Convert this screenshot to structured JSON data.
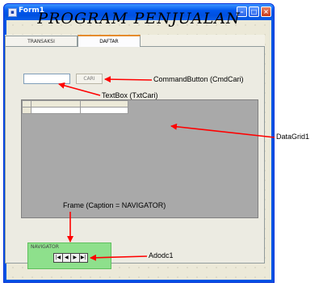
{
  "window": {
    "title": "Form1",
    "minimize_glyph": "–",
    "maximize_glyph": "□",
    "close_glyph": "×",
    "icon": "form-icon"
  },
  "form": {
    "heading": "PROGRAM PENJUALAN"
  },
  "tabs": [
    {
      "label": "TRANSAKSI",
      "selected": false
    },
    {
      "label": "DAFTAR",
      "selected": true
    }
  ],
  "search": {
    "button_label": "CARI",
    "input_value": ""
  },
  "frame": {
    "caption": "NAVIGATOR"
  },
  "navigator": {
    "buttons": [
      "|◀",
      "◀",
      "▶",
      "▶|"
    ]
  },
  "annotations": {
    "command_button": "CommandButton (CmdCari)",
    "textbox": "TextBox (TxtCari)",
    "datagrid": "DataGrid1",
    "frame": "Frame (Caption = NAVIGATOR)",
    "adodc": "Adodc1"
  },
  "colors": {
    "annotation_arrow": "#ff0000",
    "frame_fill": "#8ee08c",
    "titlebar": "#0058ee"
  }
}
